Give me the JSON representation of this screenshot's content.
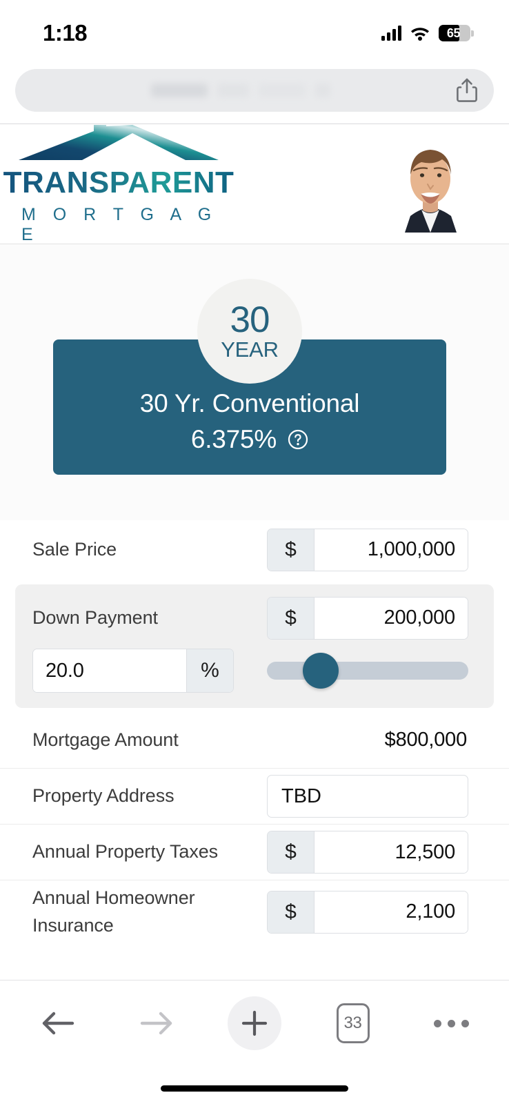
{
  "status_bar": {
    "time": "1:18",
    "battery_percent": "65",
    "signal_icon": "cellular-bars-icon",
    "wifi_icon": "wifi-icon"
  },
  "browser": {
    "url_text": "",
    "url_placeholder": "Search or enter website name",
    "share_icon": "share-icon",
    "toolbar": {
      "back_icon": "back-arrow-icon",
      "forward_icon": "forward-arrow-icon",
      "new_tab_icon": "plus-icon",
      "tab_count": "33",
      "more_icon": "more-ellipsis-icon"
    }
  },
  "site_header": {
    "logo_name": "TRANSPARENT",
    "logo_subtitle": "M O R T G A G E",
    "logo_icon": "house-roof-icon",
    "avatar_icon": "loan-officer-headshot"
  },
  "rate_card": {
    "badge_number": "30",
    "badge_word": "YEAR",
    "product_name": "30 Yr. Conventional",
    "rate": "6.375%",
    "help_icon": "question-circle-icon",
    "accent_color": "#26627d",
    "badge_bg": "#f2f2f0"
  },
  "form": {
    "rows": [
      {
        "label": "Sale Price",
        "prefix": "$",
        "value": "1,000,000"
      },
      {
        "label": "Down Payment",
        "prefix": "$",
        "value": "200,000",
        "percent_value": "20.0",
        "percent_suffix": "%",
        "slider_percent": 20
      },
      {
        "label": "Mortgage Amount",
        "value": "$800,000"
      },
      {
        "label": "Property Address",
        "value": "TBD"
      },
      {
        "label": "Annual Property Taxes",
        "prefix": "$",
        "value": "12,500"
      },
      {
        "label": "Annual Homeowner Insurance",
        "prefix": "$",
        "value": "2,100"
      }
    ]
  }
}
